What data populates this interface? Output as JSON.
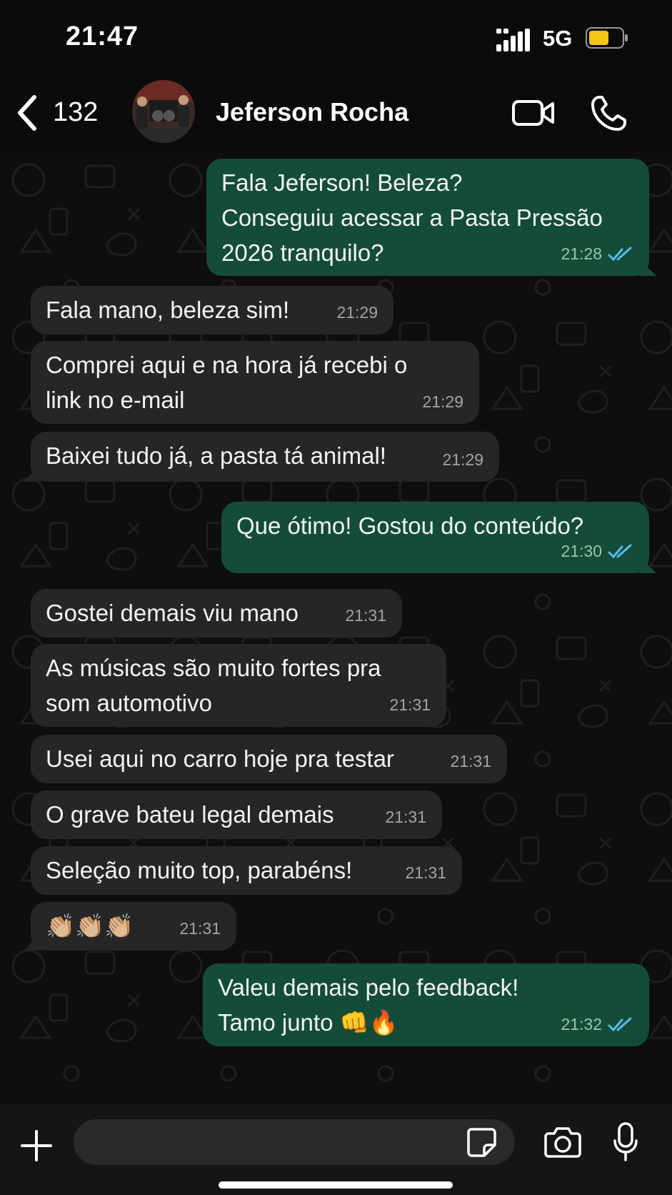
{
  "status": {
    "time": "21:47",
    "network": "5G"
  },
  "header": {
    "back_count": "132",
    "contact_name": "Jeferson Rocha"
  },
  "messages": [
    {
      "dir": "out",
      "text": "Fala Jeferson! Beleza?\nConseguiu acessar a Pasta Pressão\n2026 tranquilo?",
      "time": "21:28",
      "read": true
    },
    {
      "dir": "in",
      "text": "Fala mano, beleza sim!",
      "time": "21:29"
    },
    {
      "dir": "in",
      "text": "Comprei aqui e na hora já recebi o\nlink no e-mail",
      "time": "21:29"
    },
    {
      "dir": "in",
      "text": "Baixei tudo já, a pasta tá animal!",
      "time": "21:29"
    },
    {
      "dir": "out",
      "text": "Que ótimo! Gostou do conteúdo?",
      "time": "21:30",
      "read": true
    },
    {
      "dir": "in",
      "text": "Gostei demais viu mano",
      "time": "21:31"
    },
    {
      "dir": "in",
      "text": "As músicas são muito fortes pra\nsom automotivo",
      "time": "21:31"
    },
    {
      "dir": "in",
      "text": "Usei aqui no carro hoje pra testar",
      "time": "21:31"
    },
    {
      "dir": "in",
      "text": "O grave bateu legal demais",
      "time": "21:31"
    },
    {
      "dir": "in",
      "text": "Seleção muito top, parabéns!",
      "time": "21:31"
    },
    {
      "dir": "in",
      "text": "👏🏼👏🏼👏🏼",
      "time": "21:31"
    },
    {
      "dir": "out",
      "text": "Valeu demais pelo feedback!\nTamo junto 👊🔥",
      "time": "21:32",
      "read": true
    }
  ],
  "composer": {
    "placeholder": ""
  },
  "colors": {
    "outgoing_bubble": "#144d37",
    "incoming_bubble": "#262626",
    "read_ticks": "#53bdeb",
    "battery": "#f5c518"
  },
  "icons": [
    "back-chevron-icon",
    "video-call-icon",
    "phone-icon",
    "plus-icon",
    "sticker-icon",
    "camera-icon",
    "microphone-icon",
    "signal-icon",
    "battery-icon",
    "read-receipt-icon"
  ]
}
